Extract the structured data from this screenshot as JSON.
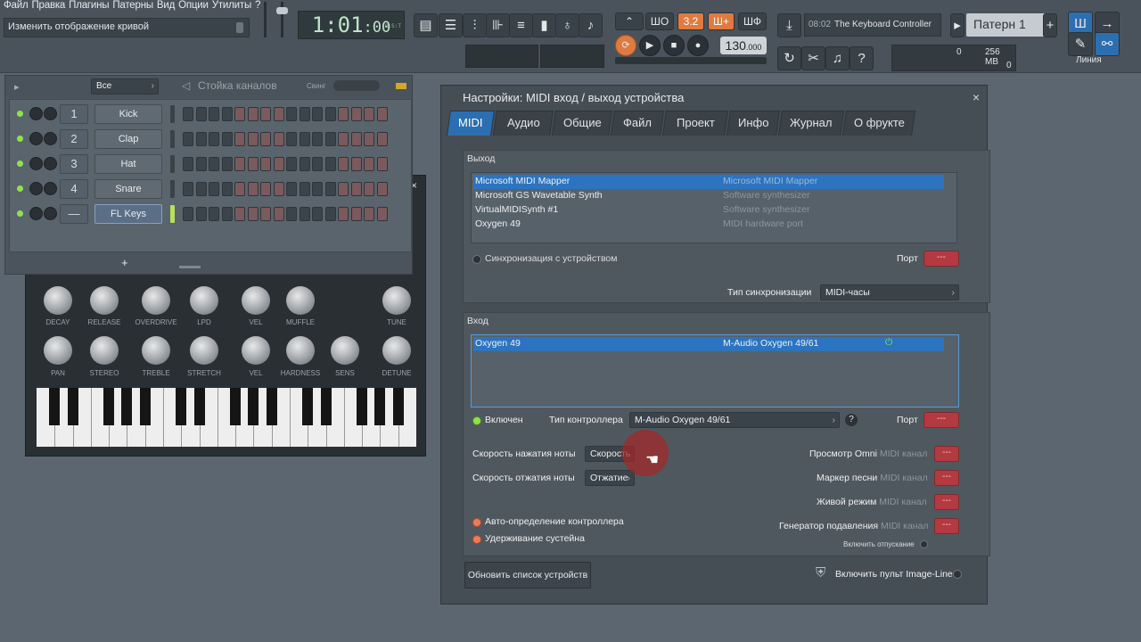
{
  "menu": [
    "Файл",
    "Правка",
    "Плагины",
    "Патерны",
    "Вид",
    "Опции",
    "Утилиты",
    "?"
  ],
  "hint_text": "Изменить отображение кривой",
  "time": {
    "main": "1:01",
    "ms": ":00",
    "bst": "B:S:T"
  },
  "transport": {
    "tempo_int": "130",
    "tempo_dec": ".000",
    "pattern_step": "3.2",
    "mode_a": "Ш+",
    "mode_b": "ШФ",
    "snap": "ШО"
  },
  "hint2": {
    "time": "08:02",
    "text": "The Keyboard Controller"
  },
  "pattern": "Патерн 1",
  "cpu": {
    "value": "0",
    "mem": "256 MB",
    "poly": "0"
  },
  "line_mode": "Линия",
  "rack": {
    "filter": "Все",
    "title": "Стойка каналов",
    "swing": "Свинг",
    "add": "+",
    "channels": [
      {
        "num": "1",
        "name": "Kick"
      },
      {
        "num": "2",
        "name": "Clap"
      },
      {
        "num": "3",
        "name": "Hat"
      },
      {
        "num": "4",
        "name": "Snare"
      },
      {
        "num": "—",
        "name": "FL Keys"
      }
    ]
  },
  "plugin": {
    "knobs_row1": [
      "DECAY",
      "RELEASE",
      "OVERDRIVE",
      "LPD",
      "VEL",
      "MUFFLE",
      "TUNE"
    ],
    "knobs_row2": [
      "PAN",
      "STEREO",
      "TREBLE",
      "STRETCH",
      "VEL",
      "HARDNESS",
      "SENS",
      "DETUNE"
    ]
  },
  "dialog": {
    "title": "Настройки: MIDI вход / выход устройства",
    "close": "×",
    "tabs": [
      "MIDI",
      "Аудио",
      "Общие",
      "Файл",
      "Проект",
      "Инфо",
      "Журнал",
      "О фрукте"
    ],
    "output": {
      "label": "Выход",
      "devices": [
        {
          "name": "Microsoft MIDI Mapper",
          "desc": "Microsoft MIDI Mapper"
        },
        {
          "name": "Microsoft GS Wavetable Synth",
          "desc": "Software synthesizer"
        },
        {
          "name": "VirtualMIDISynth #1",
          "desc": "Software synthesizer"
        },
        {
          "name": "Oxygen 49",
          "desc": "MIDI hardware port"
        }
      ],
      "sync_device": "Синхронизация с устройством",
      "port_label": "Порт",
      "port_value": "---",
      "sync_type_label": "Тип синхронизации",
      "sync_type_value": "MIDI-часы"
    },
    "input": {
      "label": "Вход",
      "device_name": "Oxygen 49",
      "device_desc": "M-Audio Oxygen 49/61",
      "enabled": "Включен",
      "controller_type_label": "Тип контроллера",
      "controller_type_value": "M-Audio Oxygen 49/61",
      "help": "?",
      "port_label": "Порт",
      "port_value": "---",
      "note_on_label": "Скорость нажатия ноты",
      "note_on_value": "Скорость",
      "note_off_label": "Скорость отжатия ноты",
      "note_off_value": "Отжатие",
      "omni_label": "Просмотр Omni",
      "song_marker_label": "Маркер песни",
      "live_label": "Живой режим",
      "suppress_label": "Генератор подавления",
      "midi_channel": "MIDI канал",
      "btn_value": "---",
      "auto_detect": "Авто-определение контроллера",
      "sustain": "Удерживание сустейна",
      "release": "Включить отпускание"
    },
    "refresh": "Обновить список устройств",
    "image_line": "Включить пульт Image-Line"
  }
}
